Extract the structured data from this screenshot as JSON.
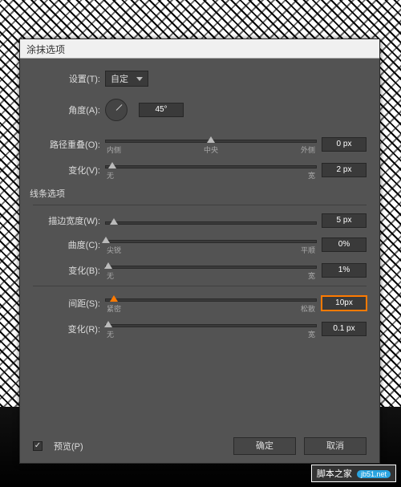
{
  "dialog": {
    "title": "涂抹选项",
    "settings_label": "设置(T):",
    "settings_value": "自定",
    "angle": {
      "label": "角度(A):",
      "value": "45°"
    },
    "path_overlap": {
      "label": "路径重叠(O):",
      "value": "0 px",
      "ticks": {
        "left": "内侧",
        "mid": "中央",
        "right": "外侧"
      },
      "thumb_pct": 50
    },
    "variation1": {
      "label": "变化(V):",
      "value": "2 px",
      "ticks": {
        "left": "无",
        "right": "宽"
      },
      "thumb_pct": 3
    },
    "line_section": "线条选项",
    "stroke_width": {
      "label": "描边宽度(W):",
      "value": "5 px",
      "thumb_pct": 4
    },
    "curvature": {
      "label": "曲度(C):",
      "value": "0%",
      "ticks": {
        "left": "尖锐",
        "right": "平顺"
      },
      "thumb_pct": 0
    },
    "variation2": {
      "label": "变化(B):",
      "value": "1%",
      "ticks": {
        "left": "无",
        "right": "宽"
      },
      "thumb_pct": 1
    },
    "spacing": {
      "label": "间距(S):",
      "value": "10px",
      "ticks": {
        "left": "紧密",
        "right": "松散"
      },
      "thumb_pct": 4
    },
    "variation3": {
      "label": "变化(R):",
      "value": "0.1 px",
      "ticks": {
        "left": "无",
        "right": "宽"
      },
      "thumb_pct": 1
    },
    "preview": {
      "label": "预览(P)",
      "checked": true
    },
    "buttons": {
      "ok": "确定",
      "cancel": "取消"
    }
  },
  "watermark": {
    "text": "脚本之家",
    "pill": "jb51.net"
  }
}
